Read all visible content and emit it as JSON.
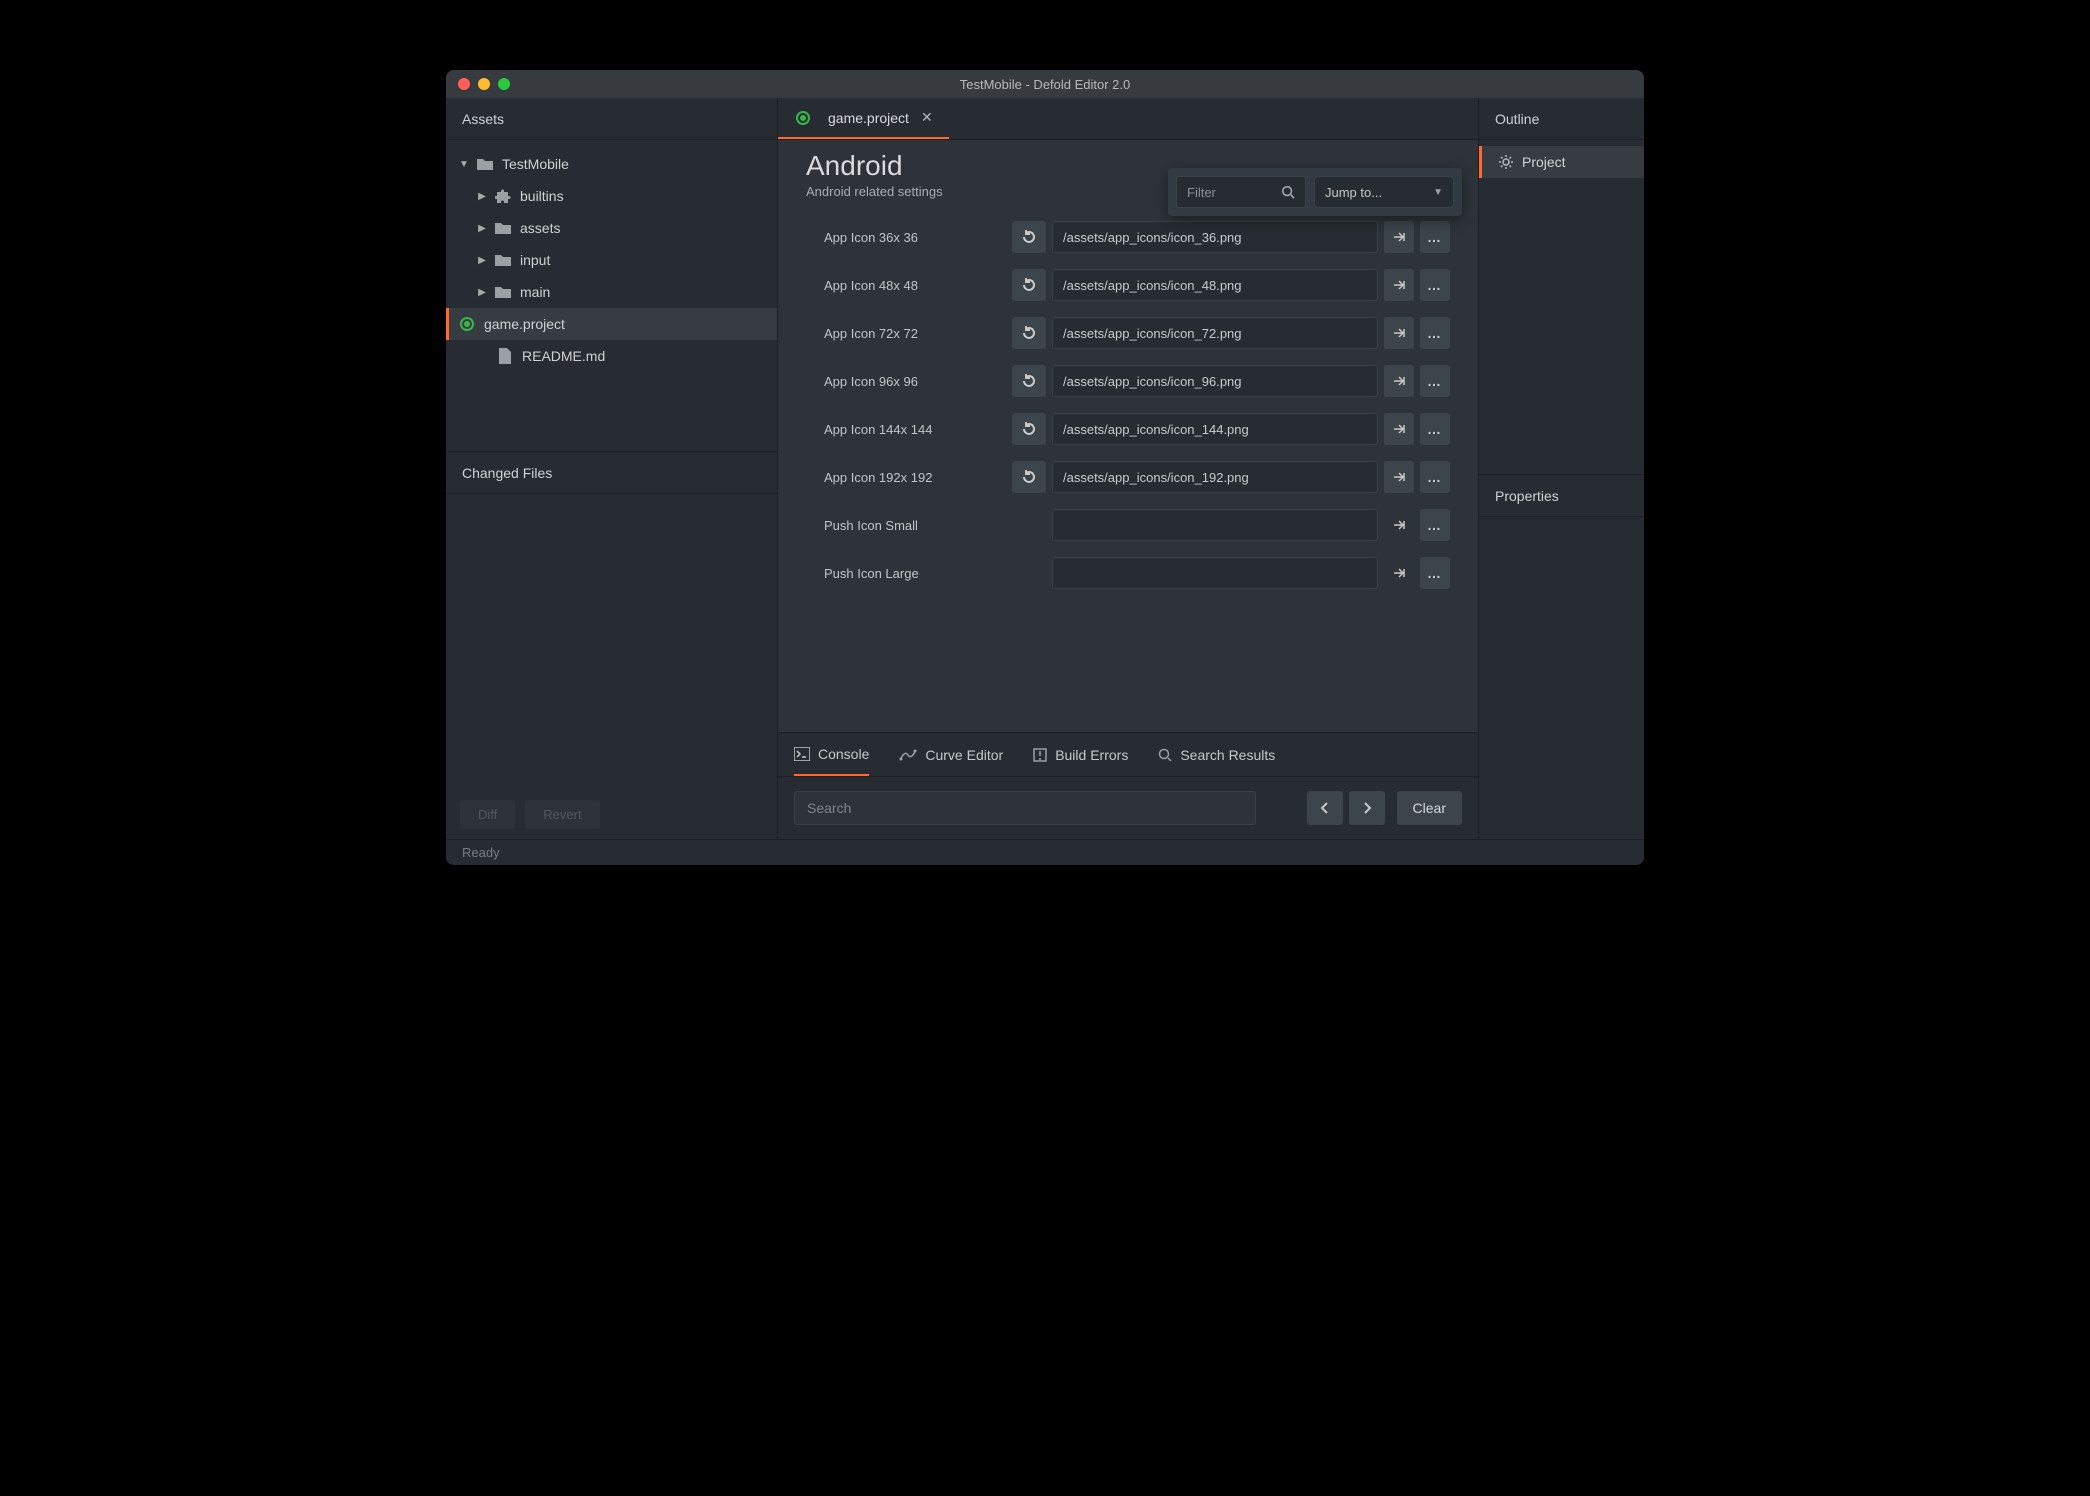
{
  "window_title": "TestMobile - Defold Editor 2.0",
  "left": {
    "assets_title": "Assets",
    "tree": {
      "root": "TestMobile",
      "items": [
        {
          "name": "builtins",
          "icon": "puzzle"
        },
        {
          "name": "assets",
          "icon": "folder"
        },
        {
          "name": "input",
          "icon": "folder"
        },
        {
          "name": "main",
          "icon": "folder"
        },
        {
          "name": "game.project",
          "icon": "defold",
          "selected": true
        },
        {
          "name": "README.md",
          "icon": "file"
        }
      ]
    },
    "changed_title": "Changed Files",
    "diff_label": "Diff",
    "revert_label": "Revert"
  },
  "center": {
    "tab_label": "game.project",
    "section": {
      "title": "Android",
      "subtitle": "Android related settings"
    },
    "filter_placeholder": "Filter",
    "jump_label": "Jump to...",
    "properties": [
      {
        "label": "App Icon 36x 36",
        "value": "/assets/app_icons/icon_36.png",
        "has_reset": true
      },
      {
        "label": "App Icon 48x 48",
        "value": "/assets/app_icons/icon_48.png",
        "has_reset": true
      },
      {
        "label": "App Icon 72x 72",
        "value": "/assets/app_icons/icon_72.png",
        "has_reset": true
      },
      {
        "label": "App Icon 96x 96",
        "value": "/assets/app_icons/icon_96.png",
        "has_reset": true
      },
      {
        "label": "App Icon 144x 144",
        "value": "/assets/app_icons/icon_144.png",
        "has_reset": true
      },
      {
        "label": "App Icon 192x 192",
        "value": "/assets/app_icons/icon_192.png",
        "has_reset": true
      },
      {
        "label": "Push Icon Small",
        "value": "",
        "has_reset": false
      },
      {
        "label": "Push Icon Large",
        "value": "",
        "has_reset": false
      }
    ],
    "bottom_tabs": {
      "console": "Console",
      "curve_editor": "Curve Editor",
      "build_errors": "Build Errors",
      "search_results": "Search Results"
    },
    "search_placeholder": "Search",
    "clear_label": "Clear"
  },
  "right": {
    "outline_title": "Outline",
    "outline_item": "Project",
    "properties_title": "Properties"
  },
  "status": "Ready"
}
